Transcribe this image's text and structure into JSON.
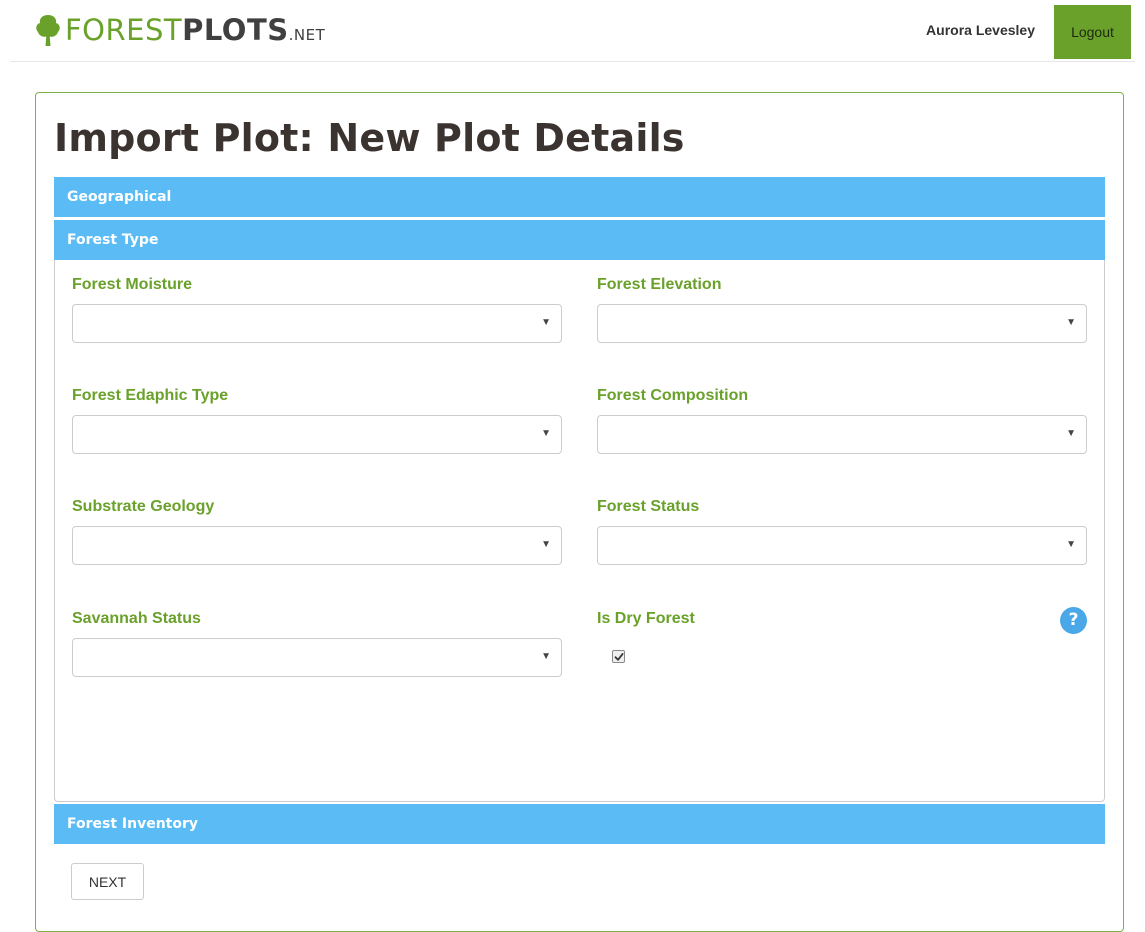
{
  "header": {
    "logo": {
      "part1": "FOREST",
      "part2": "PLOTS",
      "part3": ".NET",
      "icon": "tree-icon"
    },
    "username": "Aurora Levesley",
    "logout_label": "Logout"
  },
  "page": {
    "title": "Import Plot: New Plot Details"
  },
  "sections": {
    "geographical": "Geographical",
    "forest_type": "Forest Type",
    "forest_inventory": "Forest Inventory"
  },
  "fields": {
    "forest_moisture": {
      "label": "Forest Moisture",
      "value": ""
    },
    "forest_elevation": {
      "label": "Forest Elevation",
      "value": ""
    },
    "forest_edaphic_type": {
      "label": "Forest Edaphic Type",
      "value": ""
    },
    "forest_composition": {
      "label": "Forest Composition",
      "value": ""
    },
    "substrate_geology": {
      "label": "Substrate Geology",
      "value": ""
    },
    "forest_status": {
      "label": "Forest Status",
      "value": ""
    },
    "savannah_status": {
      "label": "Savannah Status",
      "value": ""
    },
    "is_dry_forest": {
      "label": "Is Dry Forest",
      "checked": true
    }
  },
  "help_icon": "?",
  "next_label": "NEXT",
  "colors": {
    "accent_green": "#6aa12a",
    "section_blue": "#5bbcf5",
    "help_blue": "#4aa8e8",
    "title_text": "#3b3330"
  }
}
